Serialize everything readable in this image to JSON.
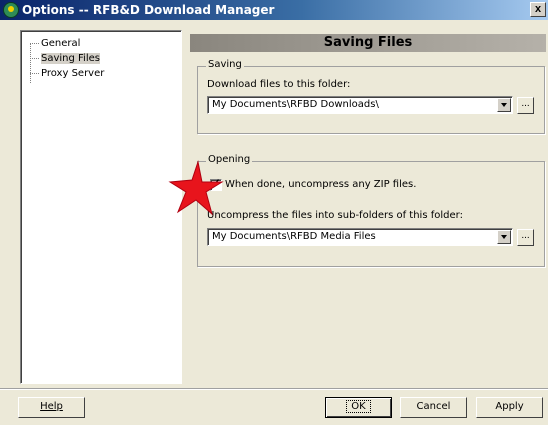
{
  "window": {
    "title": "Options -- RFB&D Download Manager",
    "close_label": "x"
  },
  "tree": {
    "items": [
      {
        "label": "General"
      },
      {
        "label": "Saving Files",
        "selected": true
      },
      {
        "label": "Proxy Server"
      }
    ]
  },
  "panel": {
    "title": "Saving Files",
    "saving": {
      "group_label": "Saving",
      "folder_label": "Download files to this folder:",
      "folder_value": "My Documents\\RFBD Downloads\\",
      "browse_label": "..."
    },
    "opening": {
      "group_label": "Opening",
      "uncompress_checkbox_label": "When done, uncompress any ZIP files.",
      "uncompress_checked": true,
      "subfolder_label": "Uncompress the files into sub-folders of this folder:",
      "subfolder_value": "My Documents\\RFBD Media Files",
      "browse_label": "..."
    }
  },
  "buttons": {
    "help": "Help",
    "ok": "OK",
    "cancel": "Cancel",
    "apply": "Apply"
  },
  "colors": {
    "titlebar": "#0a246a",
    "face": "#ece9d8",
    "annotation_star": "#e8141c"
  },
  "icons": {
    "app": "app-globe-icon",
    "dropdown": "chevron-down-icon",
    "annotation": "red-star-icon"
  }
}
